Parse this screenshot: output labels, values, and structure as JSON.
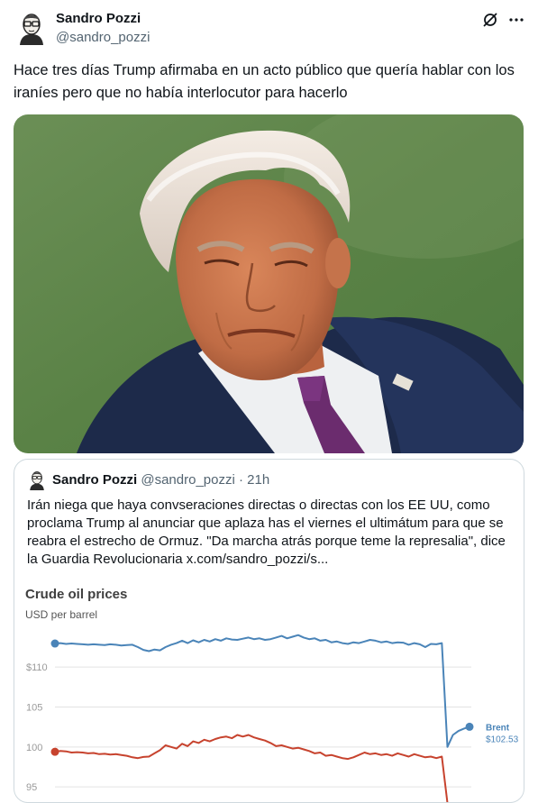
{
  "tweet": {
    "author_name": "Sandro Pozzi",
    "author_handle": "@sandro_pozzi",
    "text": "Hace tres días Trump afirmaba en un acto público que quería hablar con los iraníes pero que no había interlocutor para hacerlo",
    "icons": [
      "grok-icon",
      "more-icon"
    ]
  },
  "quote": {
    "author_name": "Sandro Pozzi",
    "author_handle": "@sandro_pozzi",
    "separator": "·",
    "time": "21h",
    "text": "Irán niega que haya convseraciones directas o directas con los EE UU, como proclama Trump al anunciar que aplaza has el viernes el ultimátum para que se reabra el estrecho de Ormuz. \"Da marcha atrás porque teme la represalia\", dice la Guardia Revolucionaria  x.com/sandro_pozzi/s..."
  },
  "chart_data": {
    "type": "line",
    "title": "Crude oil prices",
    "subtitle": "USD per barrel",
    "y_ticks": [
      "$110",
      "105",
      "100",
      "95"
    ],
    "y_tick_values": [
      110,
      105,
      100,
      95
    ],
    "ylim": [
      94,
      116
    ],
    "x_points": 76,
    "series": [
      {
        "name": "Brent",
        "end_label": "$102.53",
        "color": "#4a84b8",
        "values": [
          112.95,
          113.0,
          112.9,
          112.95,
          112.9,
          112.85,
          112.8,
          112.85,
          112.8,
          112.75,
          112.85,
          112.8,
          112.7,
          112.75,
          112.8,
          112.5,
          112.15,
          112.0,
          112.2,
          112.1,
          112.5,
          112.8,
          113.0,
          113.3,
          113.0,
          113.35,
          113.1,
          113.4,
          113.2,
          113.5,
          113.3,
          113.6,
          113.45,
          113.4,
          113.55,
          113.7,
          113.5,
          113.6,
          113.4,
          113.5,
          113.7,
          113.9,
          113.6,
          113.8,
          114.0,
          113.7,
          113.5,
          113.6,
          113.3,
          113.4,
          113.1,
          113.2,
          113.0,
          112.9,
          113.1,
          113.0,
          113.2,
          113.4,
          113.3,
          113.1,
          113.2,
          113.0,
          113.1,
          113.05,
          112.8,
          113.0,
          112.85,
          112.5,
          112.9,
          112.85,
          113.0,
          100.0,
          101.5,
          102.0,
          102.3,
          102.53
        ]
      },
      {
        "name": "",
        "color": "#c7432e",
        "values": [
          99.4,
          99.5,
          99.45,
          99.3,
          99.35,
          99.3,
          99.2,
          99.25,
          99.1,
          99.15,
          99.05,
          99.1,
          99.0,
          98.9,
          98.7,
          98.6,
          98.75,
          98.8,
          99.2,
          99.6,
          100.2,
          100.0,
          99.8,
          100.4,
          100.1,
          100.7,
          100.5,
          100.9,
          100.7,
          101.0,
          101.2,
          101.3,
          101.1,
          101.5,
          101.3,
          101.5,
          101.2,
          101.0,
          100.8,
          100.5,
          100.1,
          100.2,
          100.0,
          99.8,
          99.9,
          99.7,
          99.5,
          99.2,
          99.3,
          98.9,
          99.0,
          98.8,
          98.6,
          98.5,
          98.7,
          99.0,
          99.3,
          99.1,
          99.2,
          99.0,
          99.1,
          98.9,
          99.2,
          99.0,
          98.8,
          99.1,
          98.9,
          98.7,
          98.8,
          98.6,
          98.8,
          93.0
        ]
      }
    ],
    "grid": true
  }
}
